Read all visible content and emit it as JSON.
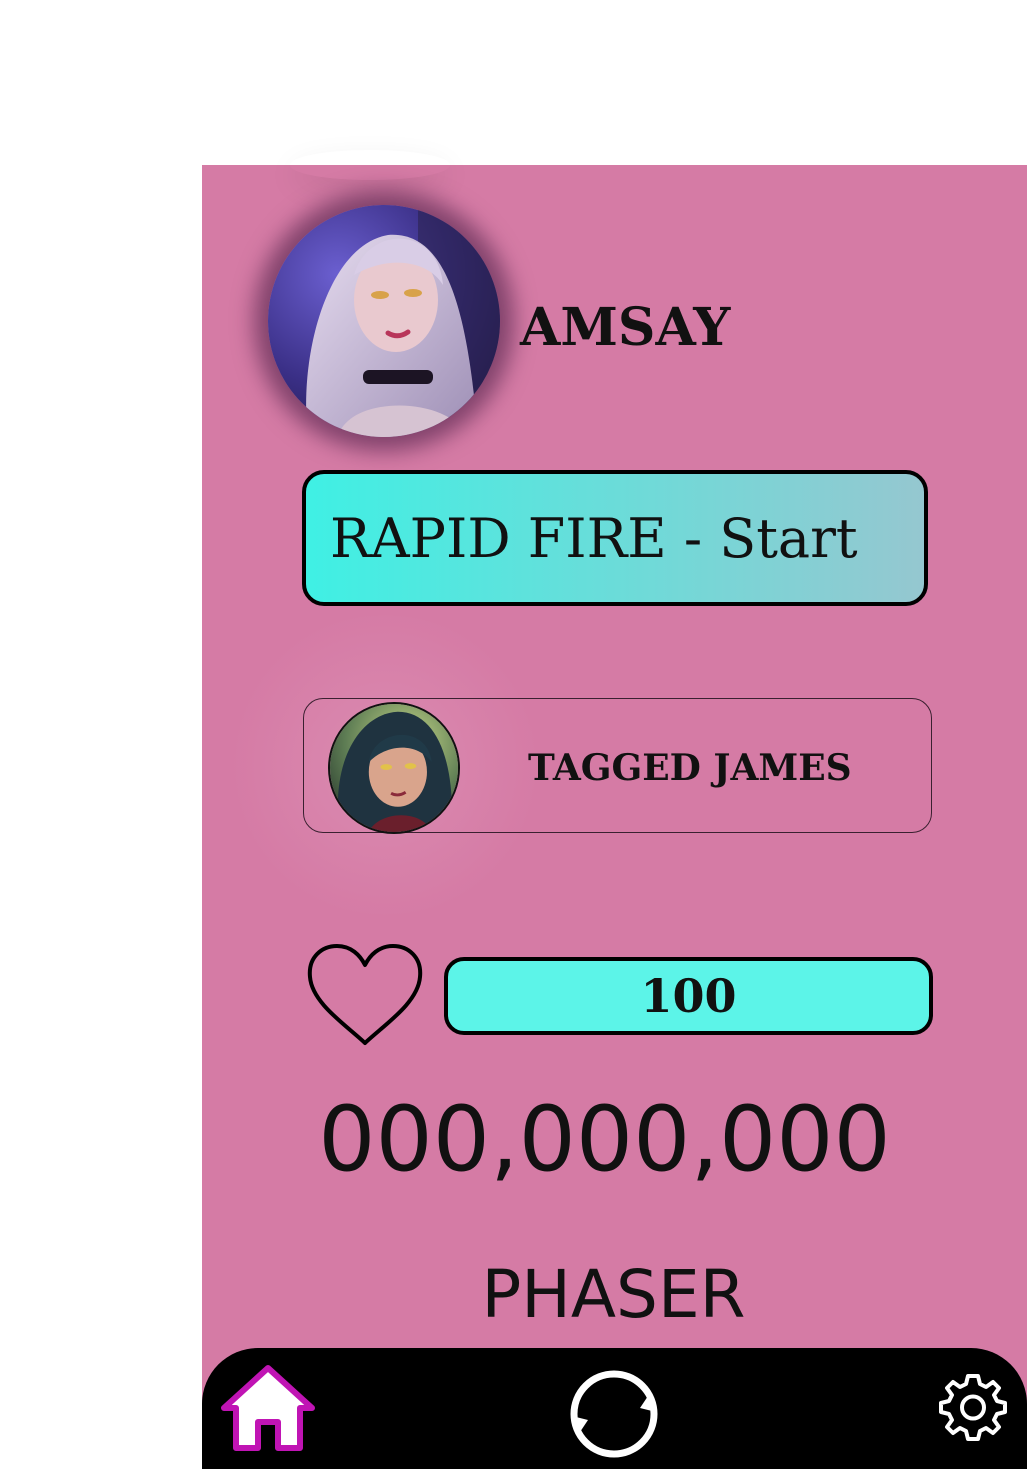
{
  "profile": {
    "username": "AMSAY"
  },
  "actions": {
    "rapid_fire_label": "RAPID FIRE - Start"
  },
  "tagged": {
    "label": "TAGGED JAMES"
  },
  "health": {
    "value": "100"
  },
  "score": {
    "value": "000,000,000"
  },
  "mode": {
    "name": "PHASER"
  },
  "nav": {
    "items": [
      {
        "icon": "home-icon",
        "active": true
      },
      {
        "icon": "refresh-icon",
        "active": false
      },
      {
        "icon": "gear-icon",
        "active": false
      }
    ]
  },
  "colors": {
    "background": "#d57ba5",
    "accent": "#5cf4e8",
    "home_active": "#c014b4",
    "nav_bg": "#000000"
  }
}
